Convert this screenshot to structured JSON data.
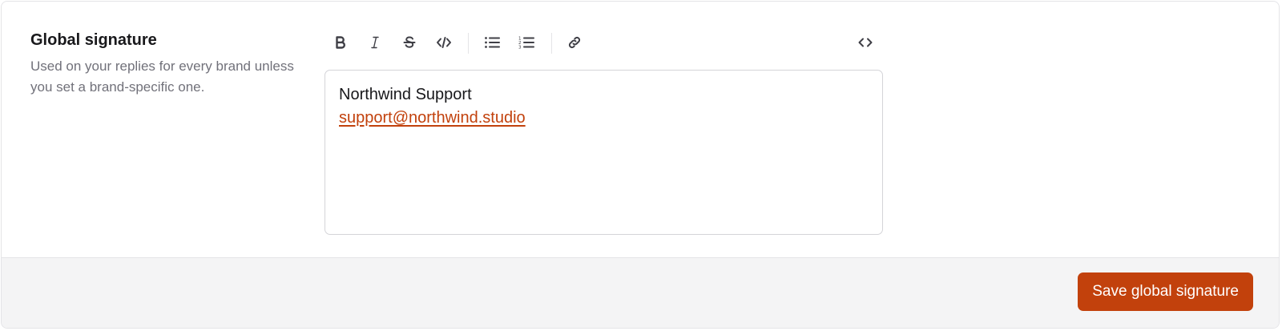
{
  "section": {
    "title": "Global signature",
    "description": "Used on your replies for every brand unless you set a brand-specific one."
  },
  "toolbar": {
    "items": [
      {
        "name": "bold",
        "icon": "bold-icon"
      },
      {
        "name": "italic",
        "icon": "italic-icon"
      },
      {
        "name": "strikethrough",
        "icon": "strikethrough-icon"
      },
      {
        "name": "inline-code",
        "icon": "code-icon"
      },
      {
        "name": "bullet-list",
        "icon": "bullet-list-icon"
      },
      {
        "name": "numbered-list",
        "icon": "numbered-list-icon"
      },
      {
        "name": "link",
        "icon": "link-icon"
      },
      {
        "name": "html-source",
        "icon": "html-source-icon"
      }
    ]
  },
  "editor": {
    "line1": "Northwind Support",
    "link_text": "support@northwind.studio"
  },
  "footer": {
    "save_label": "Save global signature"
  },
  "colors": {
    "accent": "#c2410c",
    "footer_bg": "#f4f4f5",
    "muted_text": "#71717a",
    "border": "#d4d4d8"
  }
}
